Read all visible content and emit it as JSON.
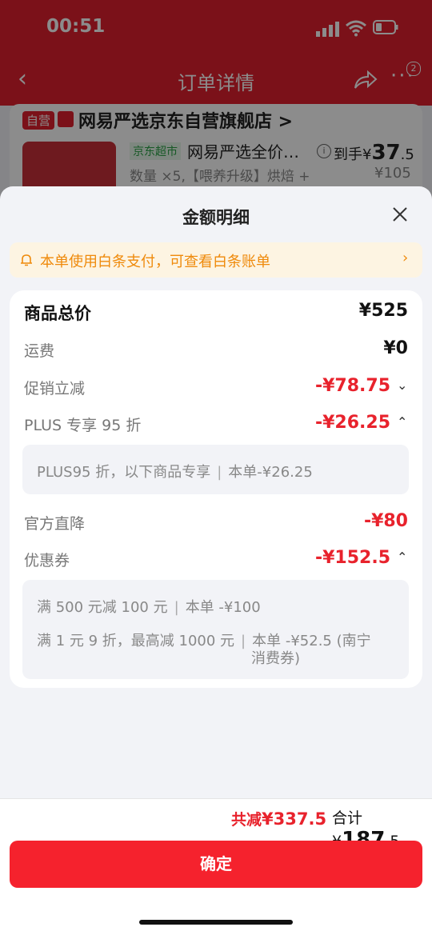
{
  "status_bar": {
    "time": "00:51"
  },
  "nav": {
    "title": "订单详情",
    "more_badge": "2"
  },
  "background_order": {
    "self_tag": "自营",
    "store_name": "网易严选京东自营旗舰店 >",
    "jd_tag": "京东超市",
    "product_name": "网易严选全价…",
    "price_label": "到手¥",
    "price_int": "37",
    "price_dec": ".5",
    "spec": "数量 ×5,【喂养升级】烘焙 +",
    "original_price": "¥105"
  },
  "sheet": {
    "title": "金额明细",
    "notice": "本单使用白条支付，可查看白条账单",
    "rows": {
      "goods_total": {
        "label": "商品总价",
        "value": "¥525"
      },
      "shipping": {
        "label": "运费",
        "value": "¥0"
      },
      "promo": {
        "label": "促销立减",
        "value": "-¥78.75"
      },
      "plus": {
        "label": "PLUS 专享 95 折",
        "value": "-¥26.25"
      },
      "plus_detail": {
        "left": "PLUS95 折，以下商品专享",
        "right": "本单-¥26.25"
      },
      "official": {
        "label": "官方直降",
        "value": "-¥80"
      },
      "coupon": {
        "label": "优惠券",
        "value": "-¥152.5"
      },
      "coupon_detail_1": {
        "left": "满 500 元减 100 元",
        "right": "本单 -¥100"
      },
      "coupon_detail_2": {
        "left": "满 1 元 9 折，最高减 1000 元",
        "right": "本单 -¥52.5 (南宁",
        "right2": "消费券)"
      }
    }
  },
  "footer": {
    "saved_label": "共减",
    "saved_value": "¥337.5",
    "total_label": "合计 ¥",
    "total_int": "187",
    "total_dec": ".5",
    "confirm": "确定"
  },
  "colors": {
    "accent": "#f5222d",
    "notice_text": "#ef8a0b",
    "notice_bg": "#fdf4e2"
  }
}
